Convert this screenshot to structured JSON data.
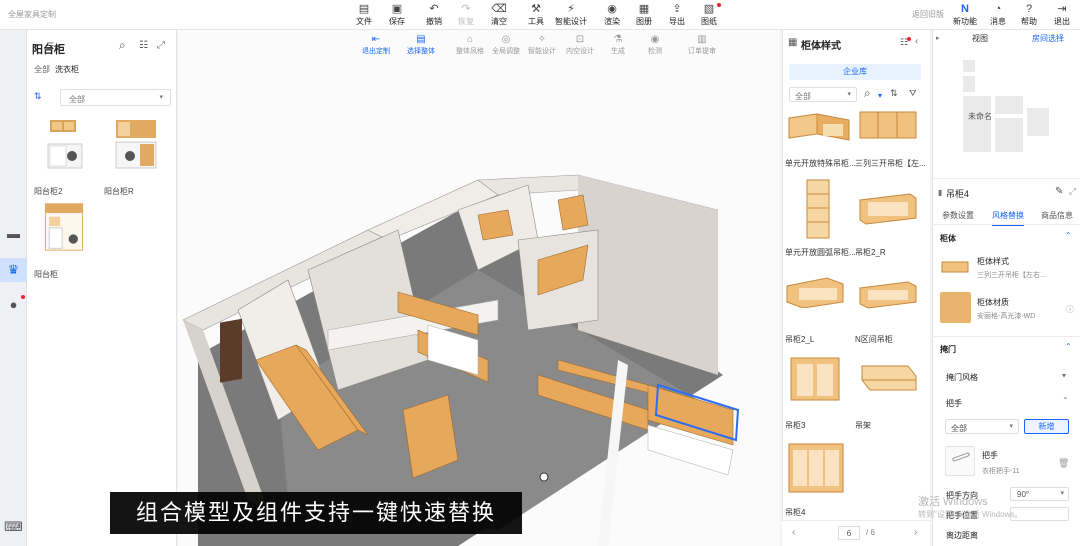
{
  "app": {
    "brand": "全屋家具定制",
    "old_version": "返回旧版"
  },
  "toolbar": [
    {
      "id": "file",
      "label": "文件",
      "icon": "file-icon",
      "glyph": "▤"
    },
    {
      "id": "save",
      "label": "保存",
      "icon": "save-icon",
      "glyph": "▣"
    },
    {
      "id": "undo",
      "label": "撤销",
      "icon": "undo-icon",
      "glyph": "↶"
    },
    {
      "id": "redo",
      "label": "恢复",
      "icon": "redo-icon",
      "glyph": "↷"
    },
    {
      "id": "clear",
      "label": "清空",
      "icon": "eraser-icon",
      "glyph": "⌫"
    },
    {
      "id": "tools",
      "label": "工具",
      "icon": "hammer-icon",
      "glyph": "⚒"
    },
    {
      "id": "smart",
      "label": "智能设计",
      "icon": "lightning-icon",
      "glyph": "⚡"
    },
    {
      "id": "render",
      "label": "渲染",
      "icon": "camera-icon",
      "glyph": "◉"
    },
    {
      "id": "gallery",
      "label": "图册",
      "icon": "gallery-icon",
      "glyph": "▦"
    },
    {
      "id": "export",
      "label": "导出",
      "icon": "export-icon",
      "glyph": "⇪"
    },
    {
      "id": "drawings",
      "label": "图纸",
      "icon": "drawing-icon",
      "glyph": "▧"
    }
  ],
  "toolbar_right": [
    {
      "id": "new",
      "label": "新功能",
      "icon": "new-feature-icon",
      "glyph": "N"
    },
    {
      "id": "msg",
      "label": "消息",
      "icon": "bell-icon",
      "glyph": "◔"
    },
    {
      "id": "help",
      "label": "帮助",
      "icon": "help-icon",
      "glyph": "?"
    },
    {
      "id": "exit",
      "label": "退出",
      "icon": "exit-icon",
      "glyph": "⇥"
    }
  ],
  "subtoolbar": [
    {
      "label": "退出定制",
      "glyph": "⇤",
      "icon": "exit-custom-icon",
      "on": true
    },
    {
      "label": "选择整体",
      "glyph": "▤",
      "icon": "select-all-icon",
      "on": true
    },
    {
      "label": "整体风格",
      "glyph": "⌂",
      "icon": "style-icon",
      "on": false
    },
    {
      "label": "全局调整",
      "glyph": "◎",
      "icon": "adjust-icon",
      "on": false
    },
    {
      "label": "智能设计",
      "glyph": "✧",
      "icon": "smart-design-icon",
      "on": false
    },
    {
      "label": "内空设计",
      "glyph": "⊡",
      "icon": "inner-design-icon",
      "on": false
    },
    {
      "label": "生成",
      "glyph": "⚗",
      "icon": "generate-icon",
      "on": false
    },
    {
      "label": "检测",
      "glyph": "◉",
      "icon": "inspect-icon",
      "on": false
    },
    {
      "label": "订单提审",
      "glyph": "▥",
      "icon": "order-icon",
      "on": false
    }
  ],
  "left_panel": {
    "title": "阳台柜",
    "crumbs": [
      "全部",
      "洗衣柜"
    ],
    "filter": "全部",
    "items": [
      "阳台柜2",
      "阳台柜R",
      "阳台柜"
    ]
  },
  "subtitle": "组合模型及组件支持一键快速替换",
  "style_panel": {
    "title": "柜体样式",
    "tab": "企业库",
    "filter": "全部",
    "items": [
      "单元开放特殊吊柜...",
      "三列三开吊柜【左...",
      "单元开放圆弧吊柜...",
      "吊柜2_R",
      "吊柜2_L",
      "N区间吊柜",
      "吊柜3",
      "吊架",
      "吊柜4",
      ""
    ],
    "page": "6",
    "total": "/ 6"
  },
  "prop_panel": {
    "view_tab": "视图",
    "room_tab": "房间选择",
    "room_label": "未命名",
    "name": "吊柜4",
    "tabs": [
      "参数设置",
      "风格替换",
      "商品信息"
    ],
    "cabinet_section": "柜体",
    "cabinet_style_label": "柜体样式",
    "cabinet_style_value": "三列三开吊柜【左右...",
    "cabinet_material_label": "柜体材质",
    "cabinet_material_value": "安丽格-高光漆-WD",
    "door_section": "掩门",
    "door_style": "掩门风格",
    "handle_section": "把手",
    "handle_filter": "全部",
    "handle_add": "新增",
    "handle_name": "把手",
    "handle_value": "衣柜把手-11",
    "handle_dir_label": "把手方向",
    "handle_dir_value": "90°",
    "handle_pos_label": "把手位置",
    "edge_label": "离边距离"
  },
  "watermark": {
    "line1": "激活 Windows",
    "line2": "转到\"设置\"以激活 Windows。"
  }
}
